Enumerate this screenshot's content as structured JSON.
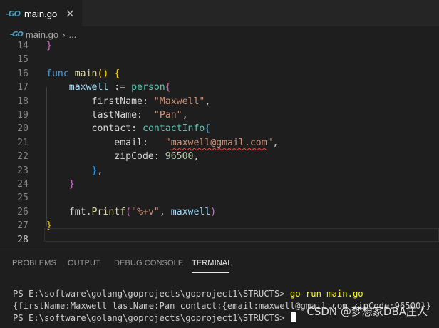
{
  "tab": {
    "icon": "go-file-icon",
    "title": "main.go",
    "close": "×"
  },
  "breadcrumb": {
    "file": "main.go",
    "separator": "›",
    "rest": "..."
  },
  "editor": {
    "active_line": "28",
    "lines": [
      {
        "n": "14",
        "tokens": [
          [
            "b2",
            "}"
          ]
        ]
      },
      {
        "n": "15",
        "tokens": []
      },
      {
        "n": "16",
        "tokens": [
          [
            "kw",
            "func"
          ],
          [
            "punct",
            " "
          ],
          [
            "fn",
            "main"
          ],
          [
            "b1",
            "()"
          ],
          [
            "punct",
            " "
          ],
          [
            "b1",
            "{"
          ]
        ]
      },
      {
        "n": "17",
        "tokens": [
          [
            "punct",
            "    "
          ],
          [
            "var",
            "maxwell"
          ],
          [
            "punct",
            " := "
          ],
          [
            "type",
            "person"
          ],
          [
            "b2",
            "{"
          ]
        ]
      },
      {
        "n": "18",
        "tokens": [
          [
            "punct",
            "        "
          ],
          [
            "punct",
            "firstName: "
          ],
          [
            "str",
            "\"Maxwell\""
          ],
          [
            "punct",
            ","
          ]
        ]
      },
      {
        "n": "19",
        "tokens": [
          [
            "punct",
            "        "
          ],
          [
            "punct",
            "lastName:  "
          ],
          [
            "str",
            "\"Pan\""
          ],
          [
            "punct",
            ","
          ]
        ]
      },
      {
        "n": "20",
        "tokens": [
          [
            "punct",
            "        "
          ],
          [
            "punct",
            "contact: "
          ],
          [
            "type",
            "contactInfo"
          ],
          [
            "b3",
            "{"
          ]
        ]
      },
      {
        "n": "21",
        "tokens": [
          [
            "punct",
            "            "
          ],
          [
            "punct",
            "email:   "
          ],
          [
            "str",
            "\""
          ],
          [
            "strsq",
            "maxwell@gmail.com"
          ],
          [
            "str",
            "\""
          ],
          [
            "punct",
            ","
          ]
        ]
      },
      {
        "n": "22",
        "tokens": [
          [
            "punct",
            "            "
          ],
          [
            "punct",
            "zipCode: "
          ],
          [
            "num",
            "96500"
          ],
          [
            "punct",
            ","
          ]
        ]
      },
      {
        "n": "23",
        "tokens": [
          [
            "punct",
            "        "
          ],
          [
            "b3",
            "}"
          ],
          [
            "punct",
            ","
          ]
        ]
      },
      {
        "n": "24",
        "tokens": [
          [
            "punct",
            "    "
          ],
          [
            "b2",
            "}"
          ]
        ]
      },
      {
        "n": "25",
        "tokens": []
      },
      {
        "n": "26",
        "tokens": [
          [
            "punct",
            "    "
          ],
          [
            "punct",
            "fmt."
          ],
          [
            "fn",
            "Printf"
          ],
          [
            "b2",
            "("
          ],
          [
            "str",
            "\"%+v\""
          ],
          [
            "punct",
            ", "
          ],
          [
            "var",
            "maxwell"
          ],
          [
            "b2",
            ")"
          ]
        ]
      },
      {
        "n": "27",
        "tokens": [
          [
            "b1",
            "}"
          ]
        ]
      },
      {
        "n": "28",
        "tokens": []
      }
    ]
  },
  "panel": {
    "tabs": [
      "PROBLEMS",
      "OUTPUT",
      "DEBUG CONSOLE",
      "TERMINAL"
    ],
    "active_tab": "TERMINAL"
  },
  "terminal": {
    "prompt1": "PS E:\\software\\golang\\goprojects\\goproject1\\STRUCTS> ",
    "command1": "go run main.go",
    "output": "{firstName:Maxwell lastName:Pan contact:{email:maxwell@gmail.com zipCode:96500}}",
    "prompt2": "PS E:\\software\\golang\\goprojects\\goproject1\\STRUCTS> "
  },
  "watermark": "CSDN @梦想家DBA庄人",
  "colors": {
    "background": "#1e1e1e",
    "tab_bar": "#252526",
    "accent": "#519aba",
    "command": "#ffff00"
  }
}
